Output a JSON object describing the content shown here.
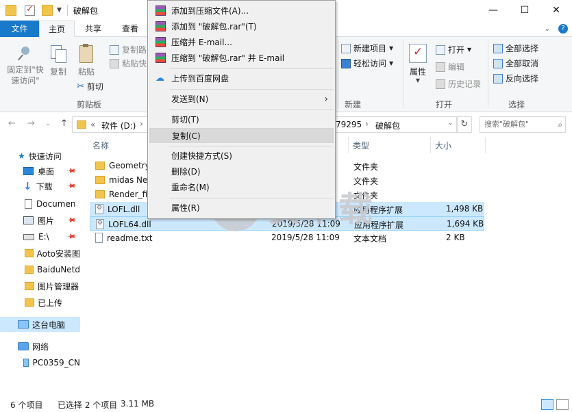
{
  "window": {
    "title": "破解包",
    "minimize": "—",
    "maximize": "☐",
    "close": "✕"
  },
  "ribbon_tabs": {
    "file": "文件",
    "home": "主页",
    "share": "共享",
    "view": "查看",
    "collapse": "⌄"
  },
  "ribbon": {
    "clipboard": {
      "pin_label": "固定到\"快速访问\"",
      "copy": "复制",
      "paste": "粘贴",
      "copy_path": "复制路",
      "paste_shortcut": "粘贴快",
      "cut": "剪切",
      "group": "剪贴板"
    },
    "new": {
      "new_item": "新建项目",
      "easy_access": "轻松访问",
      "group": "新建"
    },
    "open": {
      "properties": "属性",
      "open": "打开",
      "edit": "编辑",
      "history": "历史记录",
      "group": "打开"
    },
    "select": {
      "select_all": "全部选择",
      "select_none": "全部取消",
      "invert": "反向选择",
      "group": "选择"
    }
  },
  "address": {
    "back": "←",
    "forward": "→",
    "recent": "⌄",
    "up": "↑",
    "prefix": "«",
    "drive": "软件 (D:)",
    "segment_mid": "79295",
    "segment_last": "破解包",
    "chevron1": "›",
    "chevron2": "›",
    "dropdown": "⌄",
    "refresh": "↻",
    "search_placeholder": "搜索\"破解包\"",
    "search_icon": "⌕"
  },
  "sidebar": {
    "items": [
      {
        "label": "快速访问"
      },
      {
        "label": "桌面"
      },
      {
        "label": "下载"
      },
      {
        "label": "Documen"
      },
      {
        "label": "图片"
      },
      {
        "label": "E:\\"
      },
      {
        "label": "Aoto安装图"
      },
      {
        "label": "BaiduNetd"
      },
      {
        "label": "图片管理器"
      },
      {
        "label": "已上传"
      },
      {
        "label": "这台电脑"
      },
      {
        "label": "网络"
      },
      {
        "label": "PC0359_CN"
      }
    ]
  },
  "columns": {
    "name": "名称",
    "type": "类型",
    "size": "大小"
  },
  "files": [
    {
      "name": "Geometry_",
      "date": "",
      "type": "文件夹",
      "size": ""
    },
    {
      "name": "midas Net",
      "date": "",
      "type": "文件夹",
      "size": ""
    },
    {
      "name": "Render_fix",
      "date": "",
      "type": "文件夹",
      "size": ""
    },
    {
      "name": "LOFL.dll",
      "date": "",
      "type": "应用程序扩展",
      "size": "1,498 KB"
    },
    {
      "name": "LOFL64.dll",
      "date": "2019/5/28 11:09",
      "type": "应用程序扩展",
      "size": "1,694 KB"
    },
    {
      "name": "readme.txt",
      "date": "2019/5/28 11:09",
      "type": "文本文档",
      "size": "2 KB"
    }
  ],
  "watermark": {
    "text": "安下载",
    "sub": "anxz.com"
  },
  "context_menu": {
    "items": [
      {
        "label": "添加到压缩文件(A)..."
      },
      {
        "label": "添加到 \"破解包.rar\"(T)"
      },
      {
        "label": "压缩并 E-mail..."
      },
      {
        "label": "压缩到 \"破解包.rar\" 并 E-mail"
      },
      {
        "label": "上传到百度网盘"
      },
      {
        "label": "发送到(N)"
      },
      {
        "label": "剪切(T)"
      },
      {
        "label": "复制(C)"
      },
      {
        "label": "创建快捷方式(S)"
      },
      {
        "label": "删除(D)"
      },
      {
        "label": "重命名(M)"
      },
      {
        "label": "属性(R)"
      }
    ],
    "submenu_arrow": "›"
  },
  "status": {
    "count": "6 个项目",
    "selected": "已选择 2 个项目",
    "size": "3.11 MB"
  }
}
